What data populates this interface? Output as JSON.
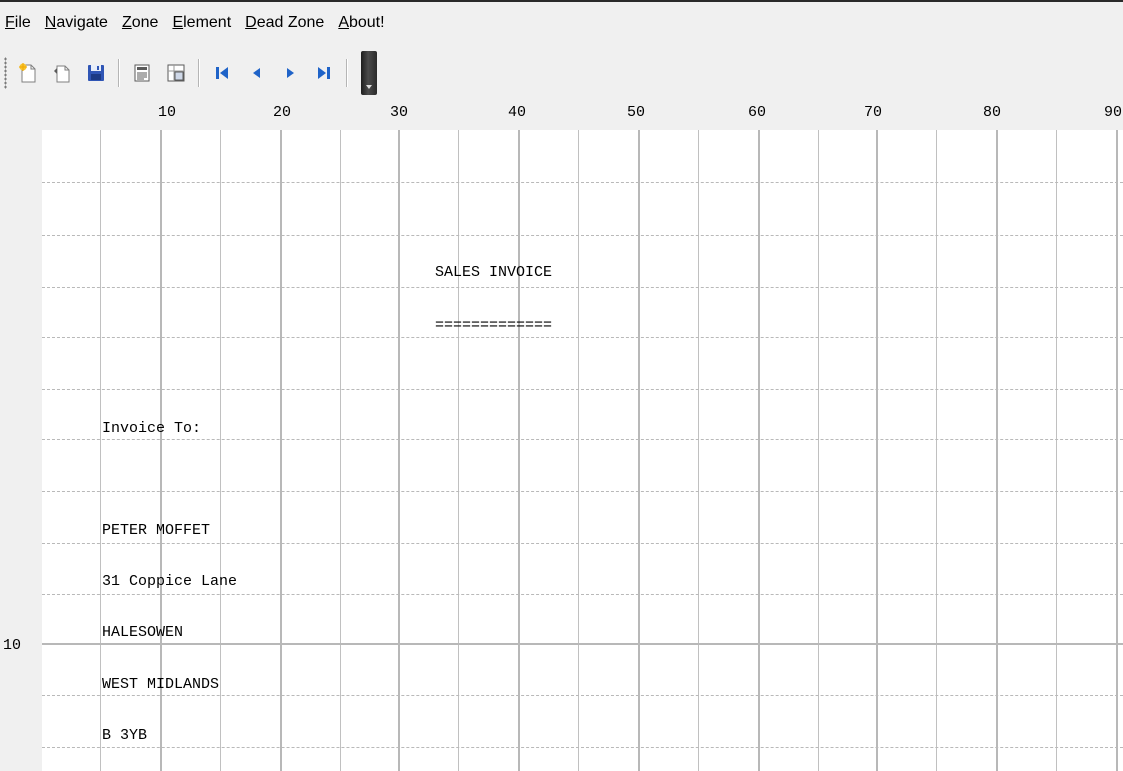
{
  "menu": [
    {
      "mnemonic": "F",
      "rest": "ile"
    },
    {
      "mnemonic": "N",
      "rest": "avigate"
    },
    {
      "mnemonic": "Z",
      "rest": "one"
    },
    {
      "mnemonic": "E",
      "rest": "lement"
    },
    {
      "mnemonic": "D",
      "rest": "ead Zone"
    },
    {
      "mnemonic": "A",
      "rest": "bout!"
    }
  ],
  "toolbar": {
    "buttons": [
      "new-document-icon",
      "open-document-icon",
      "save-icon",
      "properties-icon",
      "print-preview-icon",
      "first-record-icon",
      "previous-record-icon",
      "next-record-icon",
      "last-record-icon"
    ]
  },
  "ruler": {
    "columns": [
      "10",
      "20",
      "30",
      "40",
      "50",
      "60",
      "70",
      "80",
      "90"
    ],
    "rows": [
      "10"
    ]
  },
  "document": {
    "lines": [
      {
        "text": "SALES INVOICE"
      },
      {
        "text": "============="
      },
      {
        "text": "Invoice To:"
      },
      {
        "text": "PETER MOFFET"
      },
      {
        "text": "31 Coppice Lane"
      },
      {
        "text": "HALESOWEN"
      },
      {
        "text": "WEST MIDLANDS"
      },
      {
        "text": "B 3YB"
      }
    ]
  }
}
